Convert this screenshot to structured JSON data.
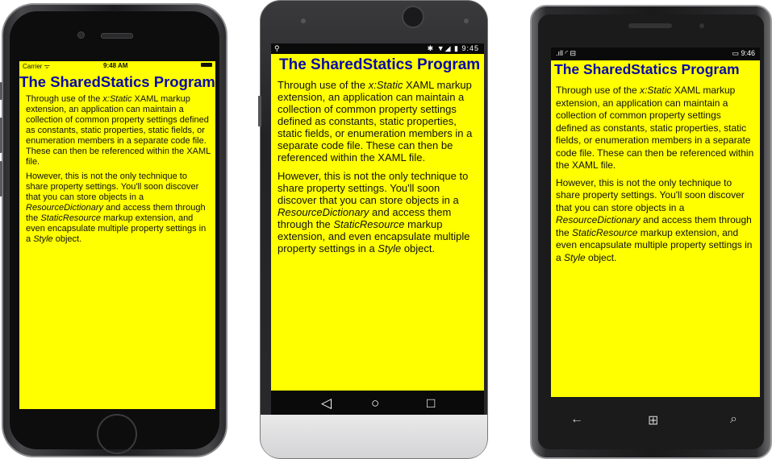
{
  "app": {
    "title": "The SharedStatics Program",
    "paragraph1": {
      "part1": "Through use of the ",
      "italic": "x:Static",
      "part2": " XAML markup extension, an application can maintain a collection of common property settings defined as constants, static properties, static fields, or enumeration members in a separate code file. These can then be referenced within the XAML file."
    },
    "paragraph2": {
      "part1": "However, this is not the only technique to share property settings. You'll soon discover that you can store objects in a ",
      "italic1": "ResourceDictionary",
      "part2": " and access them through the ",
      "italic2": "StaticResource",
      "part3": " markup extension, and even encapsulate multiple property settings in a ",
      "italic3": "Style",
      "part4": " object."
    }
  },
  "ios": {
    "status": {
      "carrier": "Carrier ᯤ",
      "time": "9:48 AM"
    }
  },
  "android": {
    "status": {
      "left": "⚲",
      "right": "✱ ▼◢ ▮ 9:45"
    },
    "nav": {
      "back": "◁",
      "home": "○",
      "recent": "□"
    }
  },
  "windows": {
    "status": {
      "left": ".ıll ◜ ⊟",
      "right": "▭ 9:46"
    },
    "nav": {
      "back": "←",
      "start": "⊞",
      "search": "⌕"
    }
  },
  "colors": {
    "screen_bg": "#ffff00",
    "title": "#0a0a a8"
  }
}
